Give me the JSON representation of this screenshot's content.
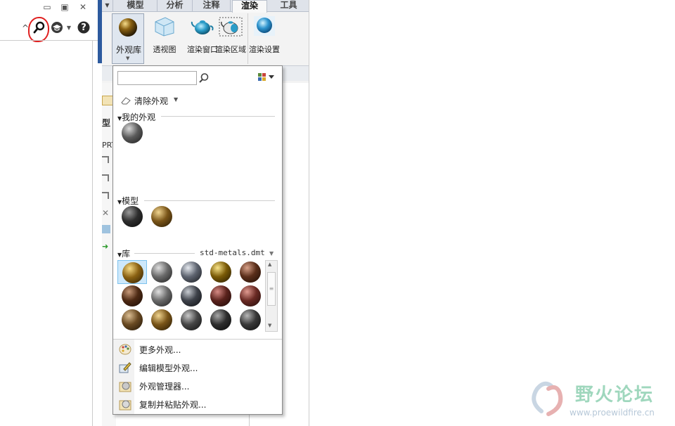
{
  "window": {
    "collapse_glyph": "^",
    "help_glyph": "?"
  },
  "ribbon": {
    "tabs": [
      "模型",
      "分析",
      "注释",
      "渲染",
      "工具"
    ],
    "active_tab": "渲染",
    "buttons": [
      {
        "label": "外观库",
        "icon": "appearance-sphere-icon"
      },
      {
        "label": "透视图",
        "icon": "perspective-cube-icon"
      },
      {
        "label": "渲染窗口",
        "icon": "render-window-teapot-icon"
      },
      {
        "label": "渲染区域",
        "icon": "render-region-teapot-icon"
      },
      {
        "label": "渲染设置",
        "icon": "render-settings-icon"
      }
    ]
  },
  "strip": {
    "label_1": "型",
    "label_2": "PRT"
  },
  "popup": {
    "search": {
      "value": "",
      "placeholder": ""
    },
    "clear_label": "清除外观",
    "my_appearances_header": "我的外观",
    "model_header": "模型",
    "library_header": "库",
    "library_file": "std-metals.dmt",
    "menu": [
      {
        "label": "更多外观...",
        "icon": "palette-icon"
      },
      {
        "label": "编辑模型外观...",
        "icon": "edit-appearance-icon"
      },
      {
        "label": "外观管理器...",
        "icon": "appearance-manager-icon"
      },
      {
        "label": "复制并粘贴外观...",
        "icon": "copy-paste-appearance-icon"
      }
    ]
  },
  "materials": {
    "my": [
      "dark-gray"
    ],
    "model": [
      "black",
      "bronze"
    ],
    "library_rows": [
      [
        "brass",
        "gray",
        "steel",
        "gold",
        "copper"
      ],
      [
        "dark-brown",
        "gray",
        "dark-steel",
        "maroon",
        "red-brown"
      ],
      [
        "brown",
        "bronze",
        "dark-gray",
        "black",
        "charcoal"
      ]
    ],
    "selected_index": 0
  },
  "watermark": {
    "title": "野火论坛",
    "url": "www.proewildfire.cn"
  }
}
